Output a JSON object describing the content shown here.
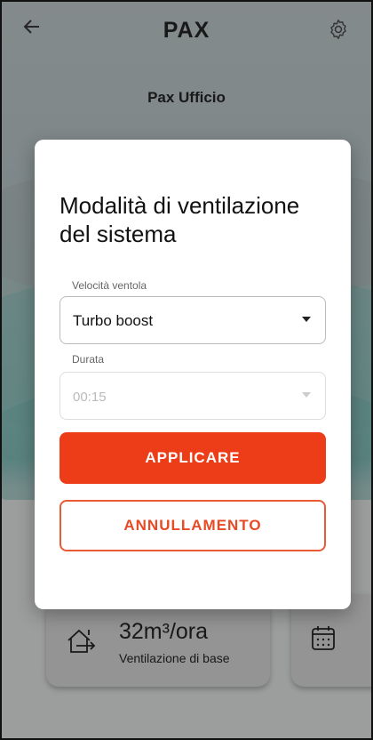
{
  "header": {
    "logo": "PAX",
    "back_icon": "arrow-left-icon",
    "settings_icon": "gear-icon"
  },
  "device": {
    "name": "Pax Ufficio"
  },
  "status_card": {
    "flow_value": "32m³/ora",
    "flow_label": "Ventilazione di base",
    "icon": "home-exit-icon"
  },
  "schedule_card": {
    "icon": "calendar-icon"
  },
  "dialog": {
    "title": "Modalità di ventilazione del sistema",
    "fan_speed": {
      "label": "Velocità ventola",
      "value": "Turbo boost"
    },
    "duration": {
      "label": "Durata",
      "value": "00:15",
      "disabled": true
    },
    "apply_label": "APPLICARE",
    "cancel_label": "ANNULLAMENTO"
  },
  "colors": {
    "primary": "#ec3d18",
    "outline": "#e85a35"
  }
}
